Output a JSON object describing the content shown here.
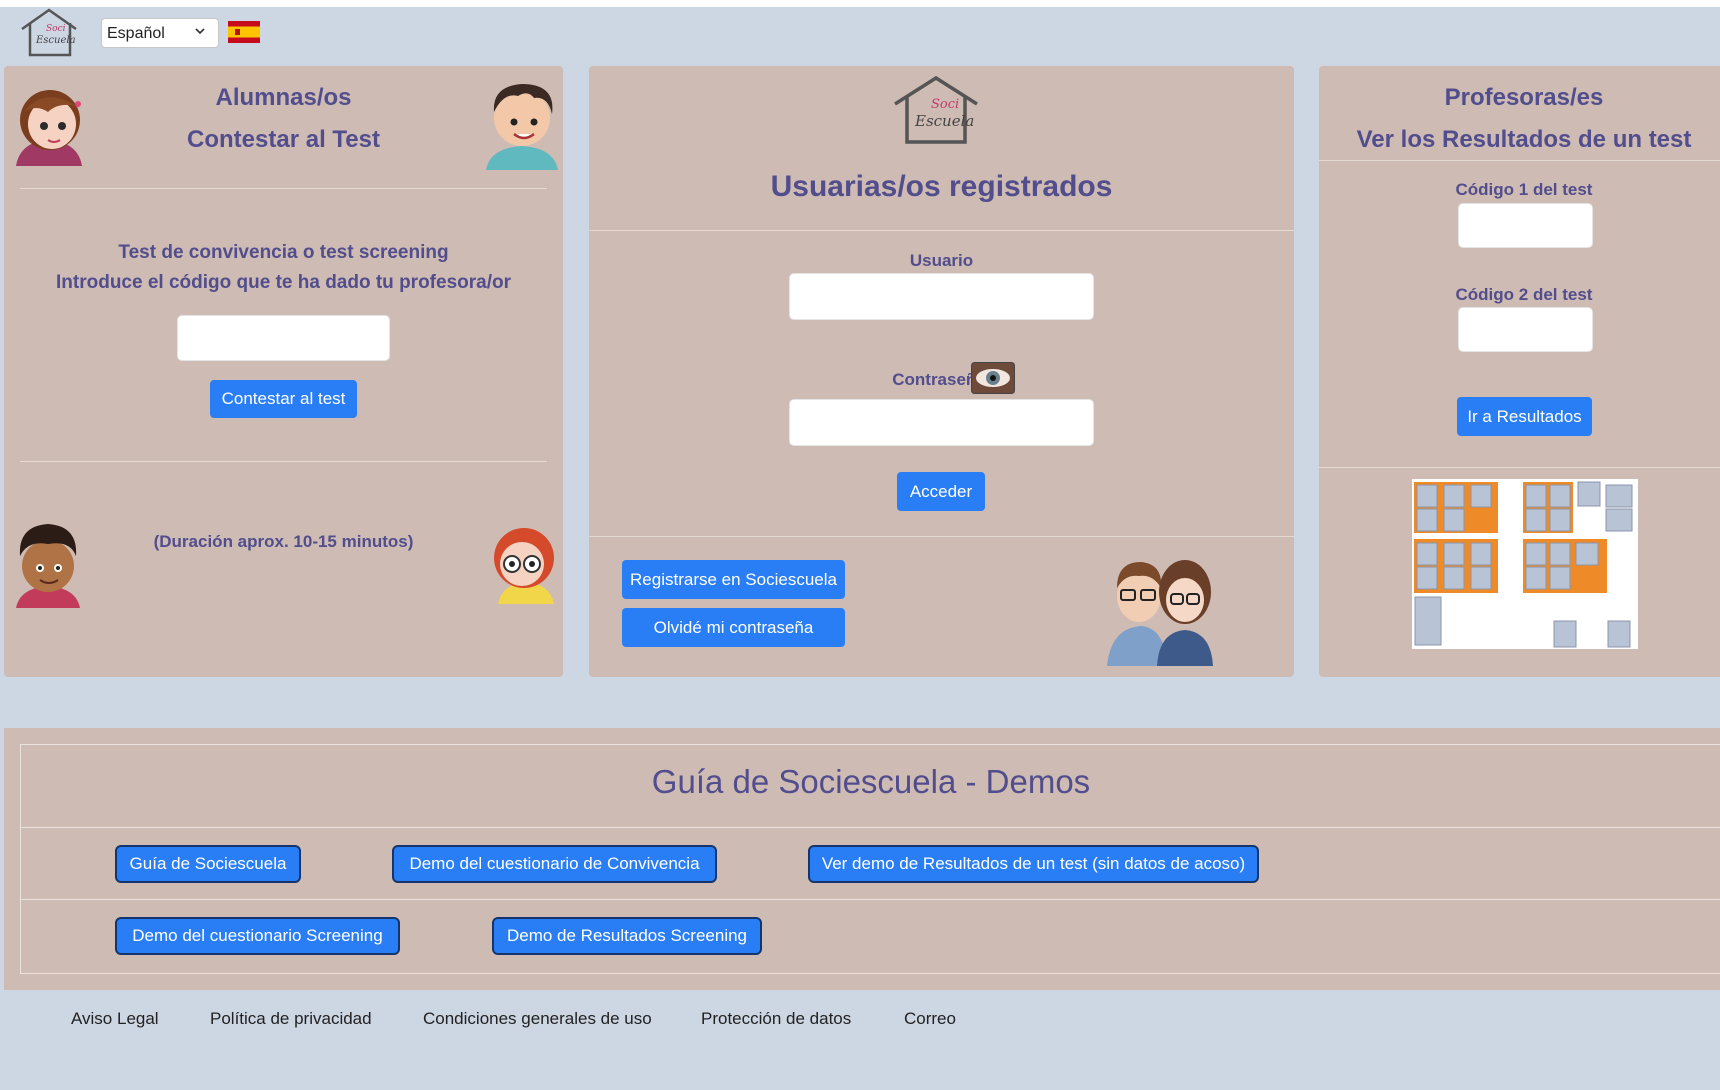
{
  "header": {
    "language_selected": "Español",
    "flag_icon": "spain-flag-icon"
  },
  "students": {
    "title_line1": "Alumnas/os",
    "title_line2": "Contestar al Test",
    "desc_line1": "Test de convivencia o test screening",
    "desc_line2": "Introduce el código que te ha dado tu profesora/or",
    "code_value": "",
    "button": "Contestar al test",
    "duration": "(Duración aprox. 10-15 minutos)"
  },
  "login": {
    "title": "Usuarias/os registrados",
    "user_label": "Usuario",
    "user_value": "",
    "password_label": "Contraseña",
    "password_value": "",
    "show_password_icon": "eye-icon",
    "submit": "Acceder",
    "register": "Registrarse en Sociescuela",
    "forgot": "Olvidé mi contraseña"
  },
  "teachers": {
    "title_line1": "Profesoras/es",
    "title_line2": "Ver los Resultados de un test",
    "code1_label": "Código 1 del test",
    "code1_value": "",
    "code2_label": "Código 2 del test",
    "code2_value": "",
    "button": "Ir a Resultados"
  },
  "guide": {
    "title": "Guía de Sociescuela - Demos",
    "buttons": [
      "Guía de Sociescuela",
      "Demo del cuestionario de Convivencia",
      "Ver demo de Resultados de un test (sin datos de acoso)",
      "Demo del cuestionario Screening",
      "Demo de Resultados Screening"
    ]
  },
  "footer": {
    "links": [
      "Aviso Legal",
      "Política de privacidad",
      "Condiciones generales de uso",
      "Protección de datos",
      "Correo"
    ]
  },
  "colors": {
    "accent": "#2a7ef5",
    "card": "#cebbb3",
    "heading": "#524d8c",
    "background": "#cdd6e3"
  }
}
